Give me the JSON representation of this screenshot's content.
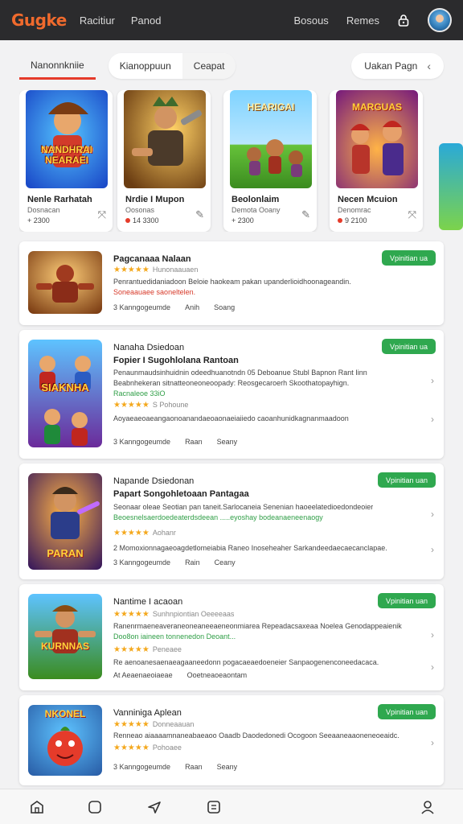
{
  "topbar": {
    "logo": "Gugke",
    "nav_left": [
      "Racitiur",
      "Panod"
    ],
    "nav_right": [
      "Bosous",
      "Remes"
    ]
  },
  "tabs": {
    "active": "Nanonnkniie",
    "group": [
      "Kianoppuun",
      "Ceapat"
    ],
    "right_label": "Uakan  Pagn"
  },
  "featured": [
    {
      "art_text": "NANDHRAI NEARAEI",
      "title": "Nenle Rarhatah",
      "sub": "Dosnacan",
      "meta": "+ 2300"
    },
    {
      "art_text": "",
      "title": "Nrdie I Mupon",
      "sub": "Oosonas",
      "meta": "14 3300"
    },
    {
      "art_text": "HEARIGAI",
      "title": "Beolonlaim",
      "sub": "Demota Ooany",
      "meta": "+ 2300"
    },
    {
      "art_text": "MARGUAS",
      "title": "Necen Mcuion",
      "sub": "Denomrac",
      "meta": "9 2100"
    }
  ],
  "list": [
    {
      "title": "Pagcanaaa Nalaan",
      "stars_label": "Hunonaauaen",
      "desc1": "Penrantuedidaniadoon Beloie haokeam pakan upanderlioidhoonageandin.",
      "desc2": "Soneaauaee saoneltelen.",
      "foot": [
        "3  Kanngogeumde",
        "Anih",
        "Soang"
      ],
      "badge": "Vpinitian ua"
    },
    {
      "head": "Nanaha  Dsiedoan",
      "title": "Fopier I Sugohlolana Rantoan",
      "desc1": "Penaunmaudsinhuidnin odeedhuanotndn 05 Deboanue Stubl Bapnon Rant Iinn",
      "desc2": "Beabnhekeran sitnatteoneoneoopady: Reosgecaroerh Skoothatopayhign.",
      "desc3": "Racnaleoe 33iO",
      "stars_label": "S  Pohoune",
      "desc4": "Aoyaeaeoaeangaonoanandaeoaonaeiaiiedo caoanhunidkagnanmaadoon",
      "foot": [
        "3  Kanngogeumde",
        "Raan",
        "Seany"
      ],
      "badge": "Vpinitian ua"
    },
    {
      "head": "Napande  Dsiedonan",
      "title": "Papart Songohletoaan Pantagaa",
      "desc1": "Seonaar oleae Seotian pan taneit.Sarlocaneia Senenian  haoeelatedioedondeoier",
      "desc2": "Beoesnelsaerdoedeaterdsdeean .....eyoshay bodeanaeneenaogy",
      "stars_label": "Aohanr",
      "desc4": "2  Momoxionnagaeoagdetlomeiabia  Raneo Inoseheaher Sarkandeedaecaecanclapae.",
      "foot": [
        "3  Kanngogeumde",
        "Rain",
        "Ceany"
      ],
      "badge": "Vpinitian uan"
    },
    {
      "head": "Nantime  I acaoan",
      "stars_label": "Sunhnpiontian Oeeeeaas",
      "desc1": "Ranenrmaeneaveraneoneaneeaeneonmiarea Repeadacsaxeaa Noelea Genodappeaienik",
      "desc2": "Doo8on iaineen tonnenedon Deoant...",
      "stars2_label": "Peneaee",
      "desc4": "Re aenoanesaenaeagaaneedonn pogacaeaedoeneier Sanpaogenenconeedacaca.",
      "foot": [
        "At  Aeaenaeoiaeae",
        "Ooetneaoeaontam"
      ],
      "badge": "Vpinitian uan"
    },
    {
      "head": "Vanniniga Aplean",
      "stars_label": "Donneaauan",
      "desc1": "Renneao aiaaaamnaneabaeaoo Oaadb Daodedonedi Ocogoon Seeaaneaaoneneoeaidc.",
      "stars2_label": "Pohoaee",
      "foot": [
        "3  Kanngogeumde",
        "Raan",
        "Seany"
      ],
      "badge": "Vpinitian uan"
    }
  ],
  "colors": {
    "accent": "#e53b2a",
    "badge": "#2fa84f",
    "logo": "#f06a2d",
    "topbar": "#2b2b2d"
  },
  "icons": [
    "lock-icon",
    "user-avatar",
    "chevron-left-icon",
    "share-icon",
    "edit-icon",
    "chevron-right-icon",
    "home-icon",
    "tablet-icon",
    "send-icon",
    "list-icon",
    "profile-icon"
  ]
}
